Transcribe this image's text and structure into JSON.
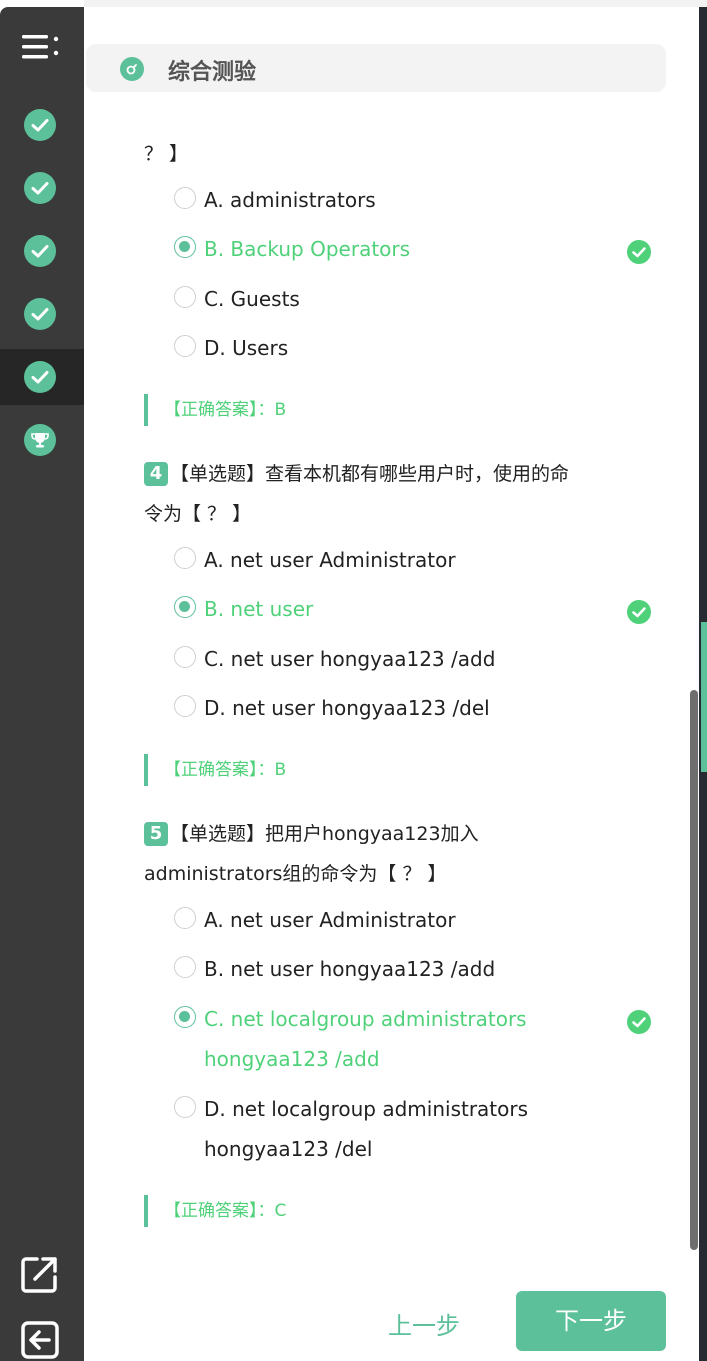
{
  "sidebar": {
    "menu_icon": "menu-list-icon",
    "steps": [
      {
        "icon": "check-icon",
        "state": "done"
      },
      {
        "icon": "check-icon",
        "state": "done"
      },
      {
        "icon": "check-icon",
        "state": "done"
      },
      {
        "icon": "check-icon",
        "state": "done"
      },
      {
        "icon": "check-icon",
        "state": "active"
      },
      {
        "icon": "trophy-icon",
        "state": "done"
      }
    ],
    "bottom_icons": [
      "external-link-icon",
      "exit-icon"
    ]
  },
  "header": {
    "icon": "quiz-icon",
    "title": "综合测验"
  },
  "q3": {
    "tail": "？ 】",
    "options": [
      "A. administrators",
      "B. Backup Operators",
      "C. Guests",
      "D. Users"
    ],
    "answer": "【正确答案】：B"
  },
  "q4": {
    "number": "4",
    "line1": "【单选题】查看本机都有哪些用户时，使用的命",
    "line2": "令为【 ？ 】",
    "options": [
      "A. net user Administrator",
      "B. net user",
      "C. net user hongyaa123 /add",
      "D. net user hongyaa123 /del"
    ],
    "answer": "【正确答案】：B"
  },
  "q5": {
    "number": "5",
    "line1": "【单选题】把用户hongyaa123加入",
    "line2": "administrators组的命令为【 ？ 】",
    "options": [
      "A. net user Administrator",
      "B. net user hongyaa123 /add",
      "C. net localgroup administrators hongyaa123 /add",
      "D. net localgroup administrators hongyaa123 /del"
    ],
    "answer": "【正确答案】：C"
  },
  "footer": {
    "prev_label": "上一步",
    "next_label": "下一步"
  },
  "colors": {
    "accent": "#5cc09a",
    "correct": "#4fd17a",
    "sidebar": "#3a3a3a"
  }
}
